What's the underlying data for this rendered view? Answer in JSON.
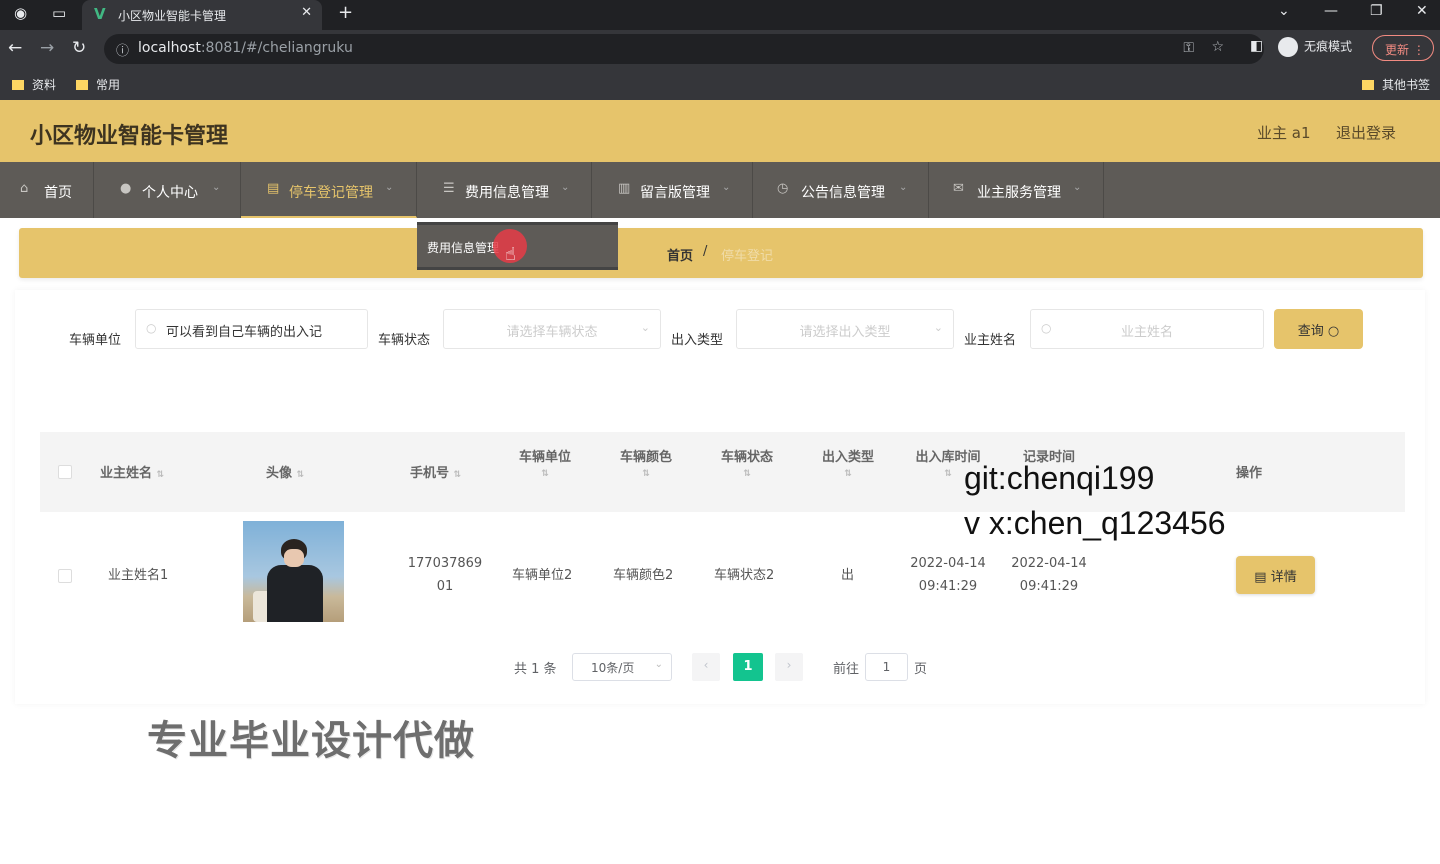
{
  "browser": {
    "tab_title": "小区物业智能卡管理",
    "url_host": "localhost",
    "url_rest": ":8081/#/cheliangruku",
    "incognito_label": "无痕模式",
    "update_label": "更新",
    "bookmarks": [
      "资料",
      "常用"
    ],
    "other_bookmarks": "其他书签"
  },
  "header": {
    "title": "小区物业智能卡管理",
    "user": "业主 a1",
    "logout": "退出登录"
  },
  "nav": {
    "items": [
      {
        "label": "首页"
      },
      {
        "label": "个人中心"
      },
      {
        "label": "停车登记管理"
      },
      {
        "label": "费用信息管理"
      },
      {
        "label": "留言版管理"
      },
      {
        "label": "公告信息管理"
      },
      {
        "label": "业主服务管理"
      }
    ],
    "dropdown_item": "费用信息管理"
  },
  "breadcrumb": {
    "home": "首页",
    "sep": "/",
    "current": "停车登记"
  },
  "filters": {
    "vehicle_unit_label": "车辆单位",
    "vehicle_unit_value": "可以看到自己车辆的出入记",
    "vehicle_status_label": "车辆状态",
    "vehicle_status_placeholder": "请选择车辆状态",
    "inout_type_label": "出入类型",
    "inout_type_placeholder": "请选择出入类型",
    "owner_name_label": "业主姓名",
    "owner_name_placeholder": "业主姓名",
    "query_button": "查询"
  },
  "table": {
    "columns": [
      "业主姓名",
      "头像",
      "手机号",
      "车辆单位",
      "车辆颜色",
      "车辆状态",
      "出入类型",
      "出入库时间",
      "记录时间",
      "操作"
    ],
    "rows": [
      {
        "owner_name": "业主姓名1",
        "phone_1": "177037869",
        "phone_2": "01",
        "vehicle_unit": "车辆单位2",
        "vehicle_color": "车辆颜色2",
        "vehicle_status": "车辆状态2",
        "inout_type": "出",
        "inout_date": "2022-04-14",
        "inout_time": "09:41:29",
        "record_date": "2022-04-14",
        "record_time": "09:41:29",
        "action": "详情"
      }
    ]
  },
  "pagination": {
    "total": "共 1 条",
    "page_size": "10条/页",
    "current_page": "1",
    "goto_label": "前往",
    "goto_value": "1",
    "page_suffix": "页"
  },
  "overlays": {
    "git": "git:chenqi199",
    "vx": "v x:chen_q123456",
    "cn": "专业毕业设计代做"
  }
}
